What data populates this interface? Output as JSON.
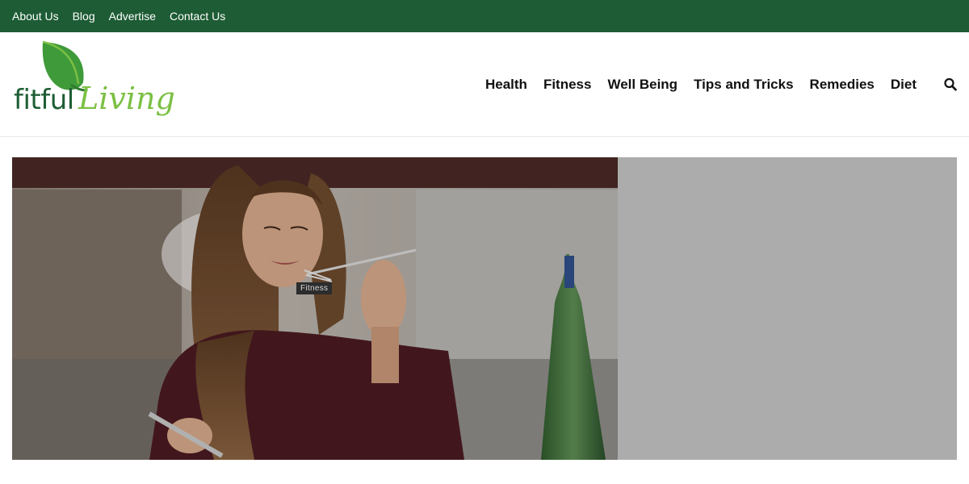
{
  "topbar": {
    "links": [
      "About Us",
      "Blog",
      "Advertise",
      "Contact Us"
    ]
  },
  "logo": {
    "part1": "fitful",
    "part2": "Living",
    "colors": {
      "dark": "#1f5e35",
      "light": "#7bc043"
    }
  },
  "nav": {
    "items": [
      "Health",
      "Fitness",
      "Well Being",
      "Tips and Tricks",
      "Remedies",
      "Diet"
    ],
    "search_icon": "search-icon"
  },
  "featured": {
    "category": "Fitness",
    "image": "woman-eating-with-fork-photo"
  },
  "colors": {
    "topbar_bg": "#1d5c34",
    "side_panel_bg": "#acacac"
  }
}
